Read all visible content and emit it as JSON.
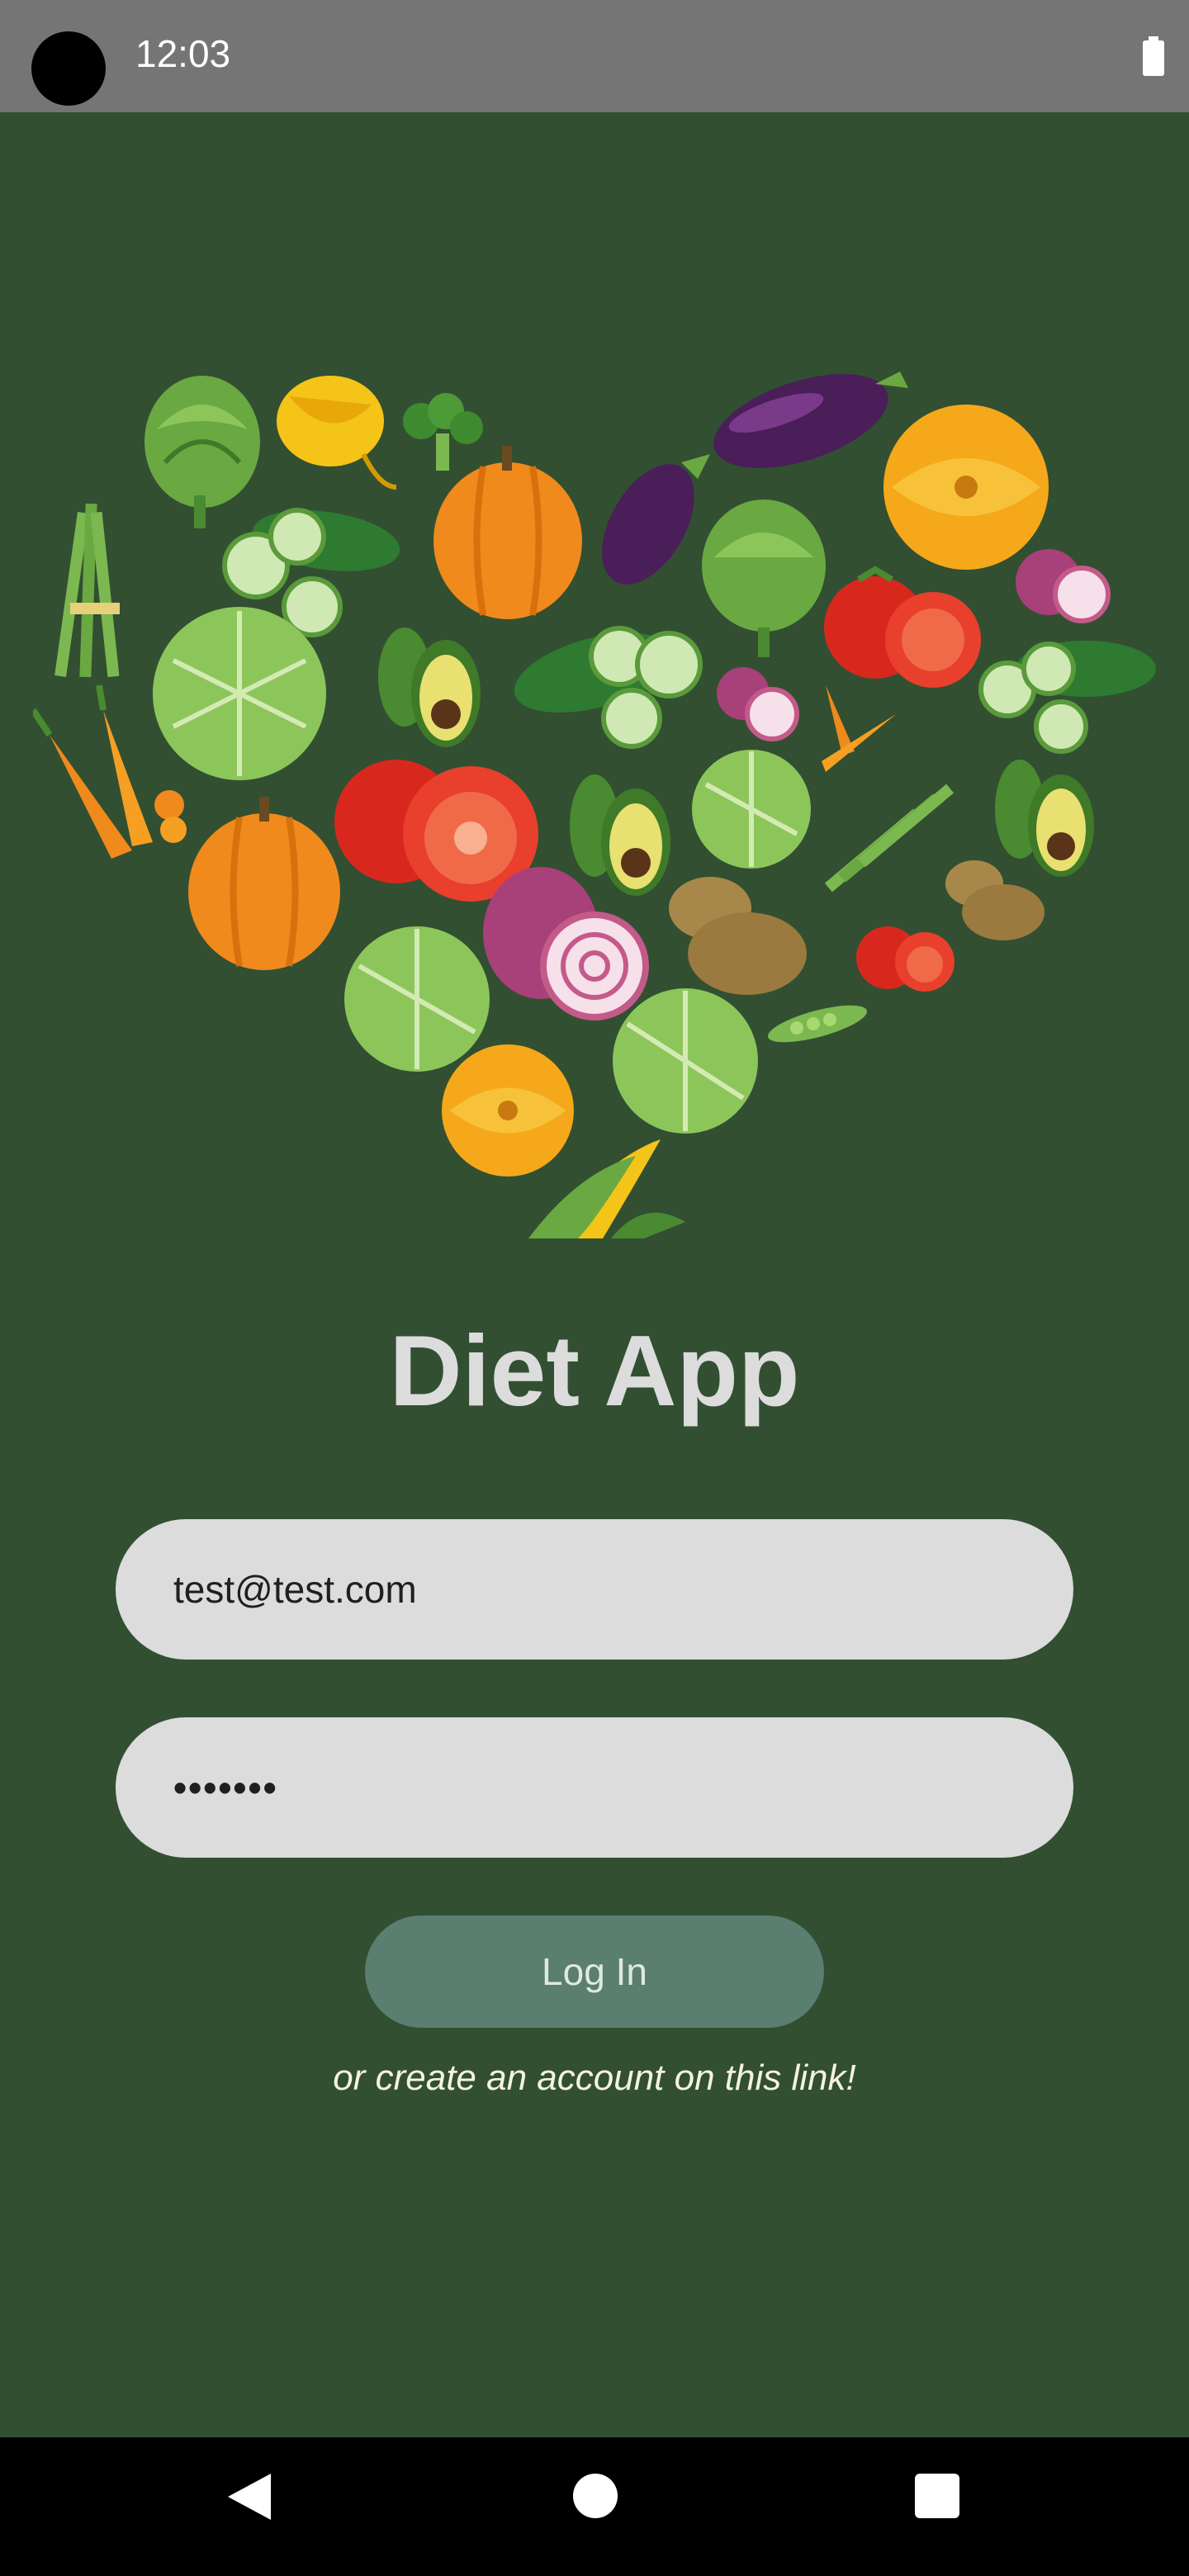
{
  "status_bar": {
    "time": "12:03",
    "battery_icon": "battery-full-icon"
  },
  "illustration": {
    "icon": "vegetable-heart-illustration"
  },
  "app": {
    "title": "Diet App"
  },
  "login_form": {
    "email_value": "test@test.com",
    "password_value": "•••••••",
    "login_label": "Log In",
    "create_account_text": "or create an account on this link!"
  },
  "colors": {
    "background": "#324f32",
    "status_bar": "#757575",
    "field_background": "#dcdcdc",
    "button_background": "#5a7e6f",
    "title_text": "#dcdcdc",
    "link_text": "#f4f4dc"
  },
  "nav_bar": {
    "back_icon": "back-triangle-icon",
    "home_icon": "home-circle-icon",
    "recents_icon": "recents-square-icon"
  }
}
